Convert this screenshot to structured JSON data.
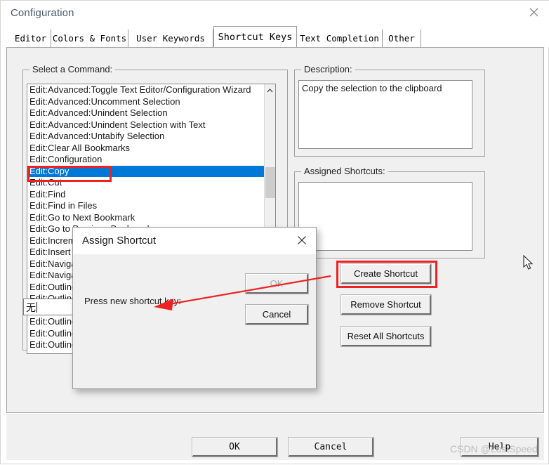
{
  "window": {
    "title": "Configuration",
    "close_icon": "close-icon"
  },
  "tabs": [
    {
      "label": "Editor",
      "selected": false
    },
    {
      "label": "Colors & Fonts",
      "selected": false
    },
    {
      "label": "User Keywords",
      "selected": false
    },
    {
      "label": "Shortcut Keys",
      "selected": true
    },
    {
      "label": "Text Completion",
      "selected": false
    },
    {
      "label": "Other",
      "selected": false
    }
  ],
  "select_command": {
    "group_label": "Select a Command:",
    "items": [
      {
        "label": "Edit:Advanced:Toggle Text Editor/Configuration Wizard",
        "selected": false
      },
      {
        "label": "Edit:Advanced:Uncomment Selection",
        "selected": false
      },
      {
        "label": "Edit:Advanced:Unindent Selection",
        "selected": false
      },
      {
        "label": "Edit:Advanced:Unindent Selection with Text",
        "selected": false
      },
      {
        "label": "Edit:Advanced:Untabify Selection",
        "selected": false
      },
      {
        "label": "Edit:Clear All Bookmarks",
        "selected": false
      },
      {
        "label": "Edit:Configuration",
        "selected": false
      },
      {
        "label": "Edit:Copy",
        "selected": true
      },
      {
        "label": "Edit:Cut",
        "selected": false
      },
      {
        "label": "Edit:Find",
        "selected": false
      },
      {
        "label": "Edit:Find in Files",
        "selected": false
      },
      {
        "label": "Edit:Go to Next Bookmark",
        "selected": false
      },
      {
        "label": "Edit:Go to Previous Bookmark",
        "selected": false
      },
      {
        "label": "Edit:Increment Search",
        "selected": false
      },
      {
        "label": "Edit:Insert File",
        "selected": false
      },
      {
        "label": "Edit:Navigate Backward",
        "selected": false
      },
      {
        "label": "Edit:Navigate Forward",
        "selected": false
      },
      {
        "label": "Edit:Outline:Collapse All",
        "selected": false
      },
      {
        "label": "Edit:Outline:Collapse Block",
        "selected": false
      },
      {
        "label": "Edit:Outline:Expand All",
        "selected": false
      },
      {
        "label": "Edit:Outline:Expand Block",
        "selected": false
      },
      {
        "label": "Edit:Outline:Hide Selection",
        "selected": false
      },
      {
        "label": "Edit:Outline:Stop Outlining",
        "selected": false
      }
    ],
    "scroll_up_icon": "chevron-up-icon"
  },
  "description": {
    "group_label": "Description:",
    "text": "Copy the selection to the clipboard"
  },
  "assigned_shortcuts": {
    "group_label": "Assigned Shortcuts:",
    "items": []
  },
  "shortcut_buttons": {
    "create": "Create Shortcut",
    "remove": "Remove Shortcut",
    "reset": "Reset All Shortcuts"
  },
  "footer": {
    "ok": "OK",
    "cancel": "Cancel",
    "help": "Help"
  },
  "modal": {
    "title": "Assign Shortcut",
    "close_icon": "close-icon",
    "prompt": "Press new shortcut key:",
    "input_value": "无",
    "input_placeholder": "",
    "ok": "OK",
    "cancel": "Cancel"
  },
  "annotations": {
    "highlight_color": "#ee2222",
    "targets": [
      "Edit:Copy",
      "Create Shortcut"
    ]
  },
  "watermark": "CSDN @LostSpeed",
  "colors": {
    "selection_blue": "#0078d7",
    "dialog_face": "#f0f0f0",
    "annotation_red": "#ee2222"
  }
}
